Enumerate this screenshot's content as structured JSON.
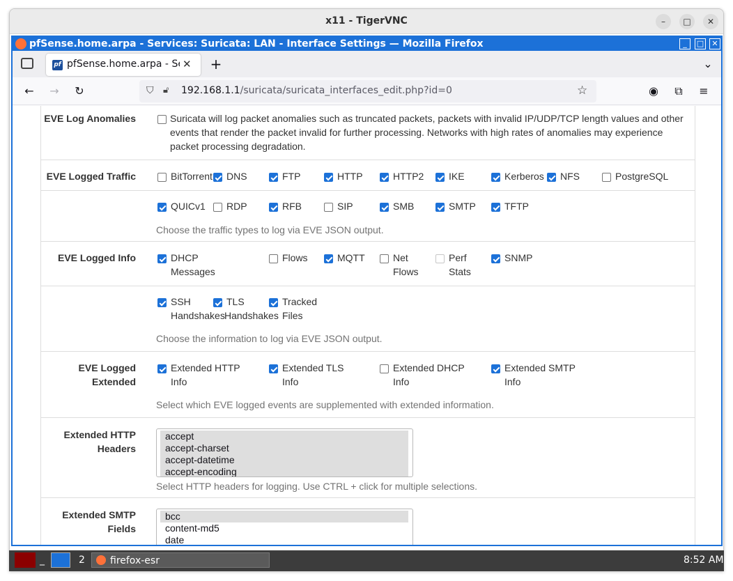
{
  "vnc": {
    "title": "x11 - TigerVNC"
  },
  "firefox": {
    "window_title": "pfSense.home.arpa - Services: Suricata: LAN - Interface Settings — Mozilla Firefox",
    "tab_title": "pfSense.home.arpa - Ser",
    "url_host": "192.168.1.1",
    "url_path": "/suricata/suricata_interfaces_edit.php?id=0"
  },
  "anomalies": {
    "label": "EVE Log Anomalies",
    "text": "Suricata will log packet anomalies such as truncated packets, packets with invalid IP/UDP/TCP length values and other events that render the packet invalid for further processing. Networks with high rates of anomalies may experience packet processing degradation.",
    "checked": false
  },
  "traffic": {
    "label": "EVE Logged Traffic",
    "row1": [
      {
        "label": "BitTorrent",
        "checked": false
      },
      {
        "label": "DNS",
        "checked": true
      },
      {
        "label": "FTP",
        "checked": true
      },
      {
        "label": "HTTP",
        "checked": true
      },
      {
        "label": "HTTP2",
        "checked": true
      },
      {
        "label": "IKE",
        "checked": true
      },
      {
        "label": "Kerberos",
        "checked": true
      },
      {
        "label": "NFS",
        "checked": true
      },
      {
        "label": "PostgreSQL",
        "checked": false
      }
    ],
    "row2": [
      {
        "label": "QUICv1",
        "checked": true
      },
      {
        "label": "RDP",
        "checked": false
      },
      {
        "label": "RFB",
        "checked": true
      },
      {
        "label": "SIP",
        "checked": false
      },
      {
        "label": "SMB",
        "checked": true
      },
      {
        "label": "SMTP",
        "checked": true
      },
      {
        "label": "TFTP",
        "checked": true
      }
    ],
    "help": "Choose the traffic types to log via EVE JSON output."
  },
  "info": {
    "label": "EVE Logged Info",
    "row1": [
      {
        "line1": "DHCP",
        "line2": "Messages",
        "checked": true,
        "disabled": false
      },
      {
        "line1": "Flows",
        "line2": "",
        "checked": false,
        "disabled": false
      },
      {
        "line1": "MQTT",
        "line2": "",
        "checked": true,
        "disabled": false
      },
      {
        "line1": "Net",
        "line2": "Flows",
        "checked": false,
        "disabled": false
      },
      {
        "line1": "Perf",
        "line2": "Stats",
        "checked": false,
        "disabled": true
      },
      {
        "line1": "SNMP",
        "line2": "",
        "checked": true,
        "disabled": false
      }
    ],
    "row2": [
      {
        "line1": "SSH",
        "line2": "Handshakes",
        "checked": true
      },
      {
        "line1": "TLS",
        "line2": "Handshakes",
        "checked": true
      },
      {
        "line1": "Tracked",
        "line2": "Files",
        "checked": true
      }
    ],
    "help": "Choose the information to log via EVE JSON output."
  },
  "extended": {
    "label_line1": "EVE Logged",
    "label_line2": "Extended",
    "items": [
      {
        "line1": "Extended HTTP",
        "line2": "Info",
        "checked": true
      },
      {
        "line1": "Extended TLS",
        "line2": "Info",
        "checked": true
      },
      {
        "line1": "Extended DHCP",
        "line2": "Info",
        "checked": false
      },
      {
        "line1": "Extended SMTP",
        "line2": "Info",
        "checked": true
      }
    ],
    "help": "Select which EVE logged events are supplemented with extended information."
  },
  "http_headers": {
    "label_line1": "Extended HTTP",
    "label_line2": "Headers",
    "options": [
      "accept",
      "accept-charset",
      "accept-datetime",
      "accept-encoding"
    ],
    "help": "Select HTTP headers for logging. Use CTRL + click for multiple selections."
  },
  "smtp_fields": {
    "label_line1": "Extended SMTP",
    "label_line2": "Fields",
    "options": [
      "bcc",
      "content-md5",
      "date"
    ]
  },
  "taskbar": {
    "workspace": "2",
    "app": "firefox-esr",
    "clock": "8:52 AM"
  }
}
